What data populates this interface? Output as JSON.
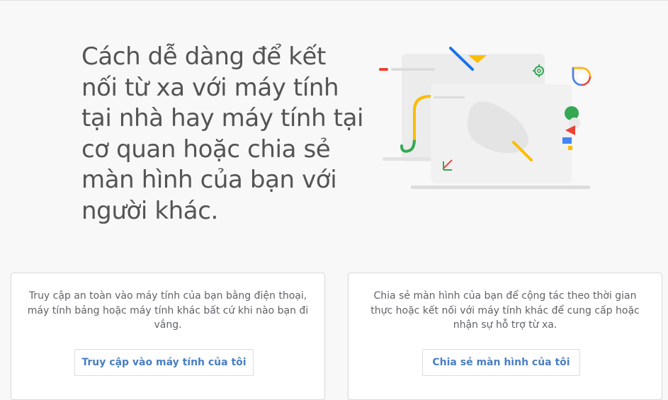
{
  "hero": {
    "heading": "Cách dễ dàng để kết nối từ xa với máy tính tại nhà hay máy tính tại cơ quan hoặc chia sẻ màn hình của bạn với người khác."
  },
  "cards": [
    {
      "description": "Truy cập an toàn vào máy tính của bạn bằng điện thoại, máy tính bảng hoặc máy tính khác bất cứ khi nào bạn đi vắng.",
      "button_label": "Truy cập vào máy tính của tôi"
    },
    {
      "description": "Chia sẻ màn hình của bạn để cộng tác theo thời gian thực hoặc kết nối với máy tính khác để cung cấp hoặc nhận sự hỗ trợ từ xa.",
      "button_label": "Chia sẻ màn hình của tôi"
    }
  ],
  "colors": {
    "background": "#f8f8f8",
    "heading_text": "#545454",
    "body_text": "#5f6368",
    "button_text": "#4a7fc1",
    "card_border": "#dadada",
    "google_blue": "#4285f4",
    "google_red": "#ea4335",
    "google_yellow": "#fbbc04",
    "google_green": "#34a853"
  },
  "icons": [
    "gear-icon",
    "chat-bubble-icon",
    "arrow-down-left-icon"
  ]
}
